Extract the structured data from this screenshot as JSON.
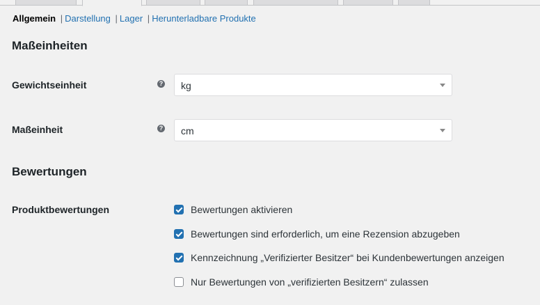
{
  "subnav": {
    "current": "Allgemein",
    "links": [
      "Darstellung",
      "Lager",
      "Herunterladbare Produkte"
    ],
    "separator": "|"
  },
  "sections": {
    "units_title": "Maßeinheiten",
    "reviews_title": "Bewertungen"
  },
  "fields": {
    "weight": {
      "label": "Gewichtseinheit",
      "value": "kg",
      "help": "?"
    },
    "dimension": {
      "label": "Maßeinheit",
      "value": "cm",
      "help": "?"
    }
  },
  "reviews": {
    "label": "Produktbewertungen",
    "options": [
      {
        "label": "Bewertungen aktivieren",
        "checked": true
      },
      {
        "label": "Bewertungen sind erforderlich, um eine Rezension abzugeben",
        "checked": true
      },
      {
        "label": "Kennzeichnung „Verifizierter Besitzer“ bei Kundenbewertungen anzeigen",
        "checked": true
      },
      {
        "label": "Nur Bewertungen von „verifizierten Besitzern“ zulassen",
        "checked": false
      }
    ]
  },
  "colors": {
    "accent": "#2271b1",
    "background": "#f1f1f1"
  }
}
